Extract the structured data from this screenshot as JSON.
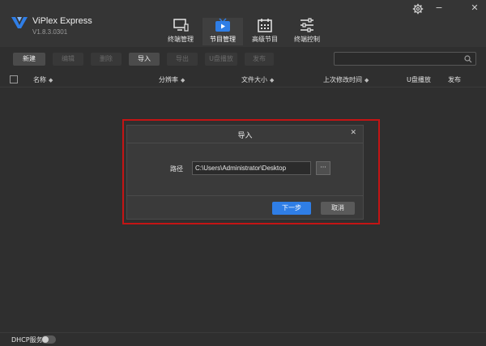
{
  "app": {
    "title": "ViPlex Express",
    "version": "V1.8.3.0301",
    "accent_color": "#2f7ee6"
  },
  "window_controls": {
    "settings_icon": "gear-icon",
    "minimize": "−",
    "close": "✕"
  },
  "nav": {
    "items": [
      {
        "label": "终端管理",
        "icon": "monitor-icon",
        "active": false
      },
      {
        "label": "节目管理",
        "icon": "tv-play-icon",
        "active": true
      },
      {
        "label": "高级节目",
        "icon": "calendar-icon",
        "active": false
      },
      {
        "label": "终端控制",
        "icon": "sliders-icon",
        "active": false
      }
    ]
  },
  "toolbar": {
    "new_label": "新建",
    "edit_label": "编辑",
    "delete_label": "删除",
    "import_label": "导入",
    "export_label": "导出",
    "usb_play_label": "U盘播放",
    "publish_label": "发布",
    "search_placeholder": ""
  },
  "table": {
    "columns": [
      {
        "label": "名称",
        "sortable": true
      },
      {
        "label": "分辨率",
        "sortable": true
      },
      {
        "label": "文件大小",
        "sortable": true
      },
      {
        "label": "上次修改时间",
        "sortable": true
      },
      {
        "label": "U盘播放",
        "sortable": false
      },
      {
        "label": "发布",
        "sortable": false
      }
    ],
    "sort_glyph": "◆"
  },
  "dialog": {
    "title": "导入",
    "close": "✕",
    "path_label": "路径",
    "path_value": "C:\\Users\\Administrator\\Desktop",
    "browse_label": "···",
    "next_label": "下一步",
    "cancel_label": "取消",
    "highlight_color": "#c41414"
  },
  "footer": {
    "dhcp_label": "DHCP服务",
    "dhcp_enabled": false
  }
}
